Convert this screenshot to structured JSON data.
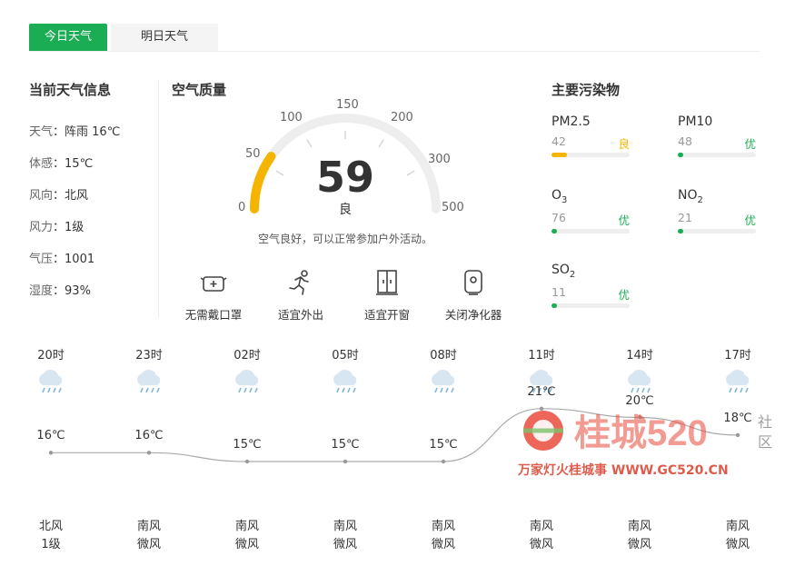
{
  "tabs": {
    "today": "今日天气",
    "tomorrow": "明日天气"
  },
  "current": {
    "title": "当前天气信息",
    "rows": [
      {
        "key": "天气",
        "value": "阵雨 16℃"
      },
      {
        "key": "体感",
        "value": "15℃"
      },
      {
        "key": "风向",
        "value": "北风"
      },
      {
        "key": "风力",
        "value": "1级"
      },
      {
        "key": "气压",
        "value": "1001"
      },
      {
        "key": "湿度",
        "value": "93%"
      }
    ]
  },
  "air": {
    "title": "空气质量",
    "aqi": "59",
    "level": "良",
    "description": "空气良好，可以正常参加户外活动。",
    "gauge_max": 500,
    "gauge_color": "#f5b400",
    "scale_labels": [
      "0",
      "50",
      "100",
      "150",
      "200",
      "300",
      "500"
    ],
    "advice": [
      {
        "icon": "mask-icon",
        "label": "无需戴口罩"
      },
      {
        "icon": "running-person-icon",
        "label": "适宜外出"
      },
      {
        "icon": "window-icon",
        "label": "适宜开窗"
      },
      {
        "icon": "air-purifier-icon",
        "label": "关闭净化器"
      }
    ]
  },
  "pollutants": {
    "title": "主要污染物",
    "items": [
      {
        "name": "PM2.5",
        "value": "42",
        "level": "良",
        "color": "#f5b400",
        "fraction": 0.2
      },
      {
        "name": "PM10",
        "value": "48",
        "level": "优",
        "color": "#1aad54",
        "fraction": 0.06
      },
      {
        "name": "O",
        "sub": "3",
        "value": "76",
        "level": "优",
        "color": "#1aad54",
        "fraction": 0.06
      },
      {
        "name": "NO",
        "sub": "2",
        "value": "21",
        "level": "优",
        "color": "#1aad54",
        "fraction": 0.06
      },
      {
        "name": "SO",
        "sub": "2",
        "value": "11",
        "level": "优",
        "color": "#1aad54",
        "fraction": 0.06
      }
    ]
  },
  "hourly": [
    {
      "time": "20时",
      "temp": "16℃",
      "t": 16,
      "wind_dir": "北风",
      "wind_level": "1级"
    },
    {
      "time": "23时",
      "temp": "16℃",
      "t": 16,
      "wind_dir": "南风",
      "wind_level": "微风"
    },
    {
      "time": "02时",
      "temp": "15℃",
      "t": 15,
      "wind_dir": "南风",
      "wind_level": "微风"
    },
    {
      "time": "05时",
      "temp": "15℃",
      "t": 15,
      "wind_dir": "南风",
      "wind_level": "微风"
    },
    {
      "time": "08时",
      "temp": "15℃",
      "t": 15,
      "wind_dir": "南风",
      "wind_level": "微风"
    },
    {
      "time": "11时",
      "temp": "21℃",
      "t": 21,
      "wind_dir": "南风",
      "wind_level": "微风"
    },
    {
      "time": "14时",
      "temp": "20℃",
      "t": 20,
      "wind_dir": "南风",
      "wind_level": "微风"
    },
    {
      "time": "17时",
      "temp": "18℃",
      "t": 18,
      "wind_dir": "南风",
      "wind_level": "微风"
    }
  ],
  "hourly_icon": "rain-cloud-icon",
  "watermark": {
    "brand": "桂城520",
    "she": "社",
    "qu": "区",
    "line": "万家灯火桂城事 WWW.GC520.CN"
  }
}
